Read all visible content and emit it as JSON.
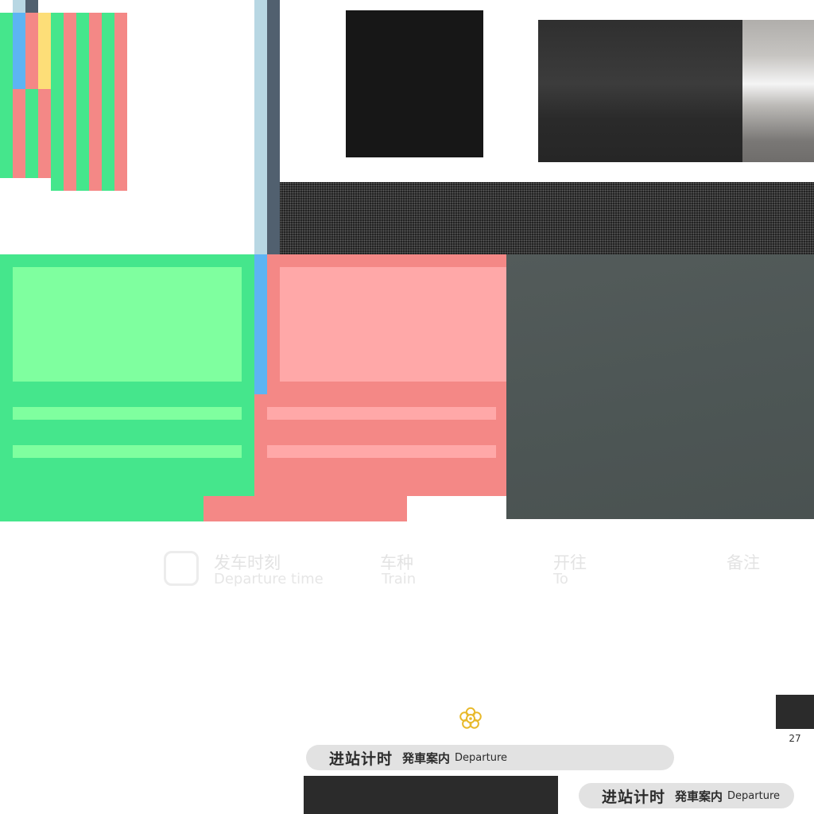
{
  "swatches": {
    "green": "#45e68c",
    "green_light": "#7fff9f",
    "pink": "#f48886",
    "pink_light": "#ffa8a8",
    "blue": "#5db4f3",
    "pale_blue": "#b8d7e3",
    "slate": "#51606f",
    "yellow": "#fdde78",
    "dark": "#171717",
    "charcoal": "#2b2b2b",
    "panel_gray": "#4d5655"
  },
  "header": {
    "departure_cn": "发车时刻",
    "departure_en": "Departure time",
    "train_cn": "车种",
    "train_en": "Train",
    "to_cn": "开往",
    "to_en": "To",
    "remarks_cn": "备注"
  },
  "page_number": "27",
  "flower_icon": "flower-icon",
  "pills": [
    {
      "cn": "进站计时",
      "jp": "発車案内",
      "en": "Departure"
    },
    {
      "cn": "进站计时",
      "jp": "発車案内",
      "en": "Departure"
    }
  ]
}
